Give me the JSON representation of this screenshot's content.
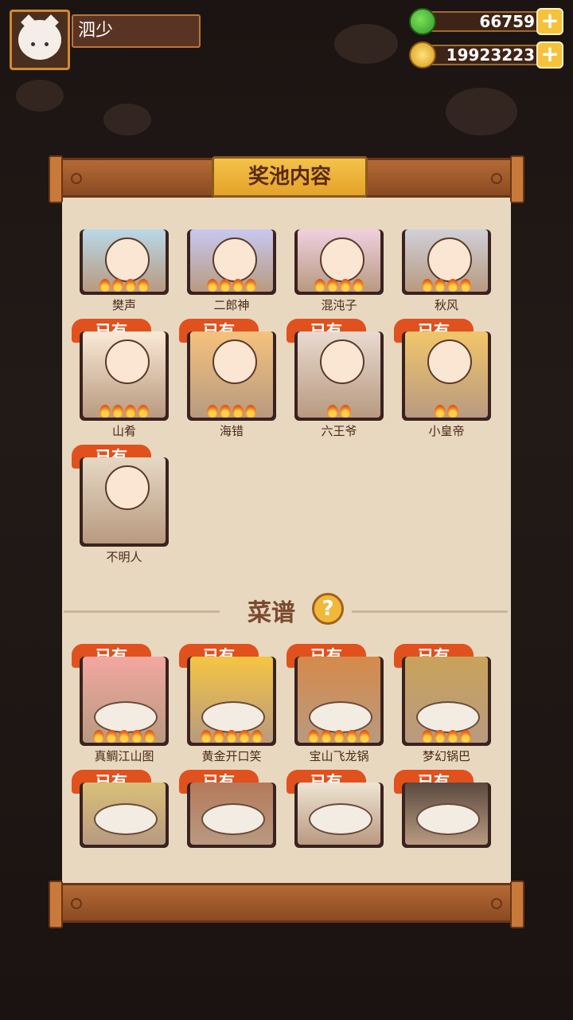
{
  "player": {
    "name": "泗少"
  },
  "currency": {
    "apples": "66759",
    "coins": "19923223"
  },
  "panel": {
    "title": "奖池内容"
  },
  "characters": [
    {
      "name": "樊声",
      "owned": false,
      "stars": 4,
      "color": "#b8d8e8"
    },
    {
      "name": "二郎神",
      "owned": false,
      "stars": 4,
      "color": "#c8c8f0"
    },
    {
      "name": "混沌子",
      "owned": false,
      "stars": 4,
      "color": "#f0d0e0"
    },
    {
      "name": "秋风",
      "owned": false,
      "stars": 4,
      "color": "#d0d0d8"
    },
    {
      "name": "山肴",
      "owned": true,
      "owned_label": "已有",
      "stars": 4,
      "color": "#fbe9d6"
    },
    {
      "name": "海错",
      "owned": true,
      "owned_label": "已有",
      "stars": 4,
      "color": "#f6c27d"
    },
    {
      "name": "六王爷",
      "owned": true,
      "owned_label": "已有",
      "stars": 2,
      "color": "#e9dad0"
    },
    {
      "name": "小皇帝",
      "owned": true,
      "owned_label": "已有",
      "stars": 2,
      "color": "#f2c66a"
    },
    {
      "name": "不明人",
      "owned": true,
      "owned_label": "已有",
      "stars": 0,
      "color": "#e6d8c4"
    }
  ],
  "recipes_section": {
    "title": "菜谱"
  },
  "recipes": [
    {
      "name": "真鲷江山图",
      "owned": true,
      "owned_label": "已有",
      "stars": 5,
      "color": "#f3a7a0"
    },
    {
      "name": "黄金开口笑",
      "owned": true,
      "owned_label": "已有",
      "stars": 5,
      "color": "#f5c542"
    },
    {
      "name": "宝山飞龙锅",
      "owned": true,
      "owned_label": "已有",
      "stars": 5,
      "color": "#d68a4a"
    },
    {
      "name": "梦幻锅巴",
      "owned": true,
      "owned_label": "已有",
      "stars": 4,
      "color": "#c9a35a"
    },
    {
      "name": "",
      "owned": true,
      "owned_label": "已有",
      "stars": 0,
      "color": "#d9c078"
    },
    {
      "name": "",
      "owned": true,
      "owned_label": "已有",
      "stars": 0,
      "color": "#b5795a"
    },
    {
      "name": "",
      "owned": true,
      "owned_label": "已有",
      "stars": 0,
      "color": "#efe4d4"
    },
    {
      "name": "",
      "owned": true,
      "owned_label": "已有",
      "stars": 0,
      "color": "#5a4a40"
    }
  ]
}
